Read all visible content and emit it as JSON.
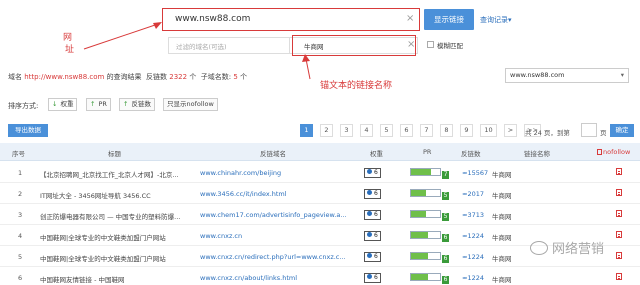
{
  "search": {
    "value": "www.nsw88.com",
    "query_button": "显示链接",
    "history_link": "查询记录",
    "history_caret": "▾",
    "clear_glyph": "×"
  },
  "filter": {
    "domain_placeholder": "过滤的域名(可选)",
    "anchor_value": "牛商网",
    "fuzzy_match_label": "模糊匹配"
  },
  "annotations": {
    "url_label_line1": "网",
    "url_label_line2": "址",
    "anchor_note": "锚文本的链接名称"
  },
  "summary": {
    "domain_label": "域名",
    "domain_value": "http://www.nsw88.com",
    "result_label": "的查询结果",
    "link_count_label": "反链数",
    "link_count": "2322",
    "unit": "个",
    "subdomain_label": "子域名数:",
    "subdomain_count": "5"
  },
  "domain_select": {
    "value": "www.nsw88.com",
    "caret": "▾"
  },
  "sort": {
    "label": "排序方式:",
    "options": [
      {
        "label": "权重",
        "arrow": "↓"
      },
      {
        "label": "PR",
        "arrow": "↑"
      },
      {
        "label": "反链数",
        "arrow": "↑"
      },
      {
        "label": "只显示nofollow",
        "arrow": ""
      }
    ]
  },
  "toolbar": {
    "export_label": "导出数据"
  },
  "pagination": {
    "pages": [
      "1",
      "2",
      "3",
      "4",
      "5",
      "6",
      "7",
      "8",
      "9",
      "10",
      ">",
      ">>"
    ],
    "active_page": 1,
    "total_label": "共 24 页，到第",
    "page_unit": "页",
    "go_label": "确定"
  },
  "table": {
    "headers": {
      "num": "序号",
      "title": "标题",
      "domain": "反链域名",
      "weight": "权重",
      "pr": "PR",
      "count": "反链数",
      "anchor": "链接名称",
      "nofollow": "nofollow"
    },
    "rows": [
      {
        "num": "1",
        "title": "【北京招聘网_北京找工作_北京人才网】-北京...",
        "url": "www.chinahr.com/beijing",
        "weight": "6",
        "pr": "7",
        "count": "≈15567",
        "anchor": "牛商网"
      },
      {
        "num": "2",
        "title": "IT网址大全 - 3456网址导航 3456.CC",
        "url": "www.3456.cc/it/index.html",
        "weight": "6",
        "pr": "5",
        "count": "≈2017",
        "anchor": "牛商网"
      },
      {
        "num": "3",
        "title": "创正防爆电器有限公司 — 中国专业的塑料防爆...",
        "url": "www.chem17.com/advertisinfo_pageview.a...",
        "weight": "6",
        "pr": "5",
        "count": "≈3713",
        "anchor": "牛商网"
      },
      {
        "num": "4",
        "title": "中国鞋网|全球专业的中文鞋类加盟门户网站",
        "url": "www.cnxz.cn",
        "weight": "6",
        "pr": "6",
        "count": "≈1224",
        "anchor": "牛商网"
      },
      {
        "num": "5",
        "title": "中国鞋网|全球专业的中文鞋类加盟门户网站",
        "url": "www.cnxz.cn/redirect.php?url=www.cnxz.c...",
        "weight": "6",
        "pr": "6",
        "count": "≈1224",
        "anchor": "牛商网"
      },
      {
        "num": "6",
        "title": "中国鞋网友情链接 - 中国鞋网",
        "url": "www.cnxz.cn/about/links.html",
        "weight": "6",
        "pr": "6",
        "count": "≈1224",
        "anchor": "牛商网"
      }
    ]
  },
  "watermark": {
    "text": "网络营销"
  },
  "colors": {
    "accent": "#4a90d9",
    "annotation_red": "#d83a3a",
    "link": "#2a6ebb",
    "pr_green": "#3a9b3a"
  }
}
